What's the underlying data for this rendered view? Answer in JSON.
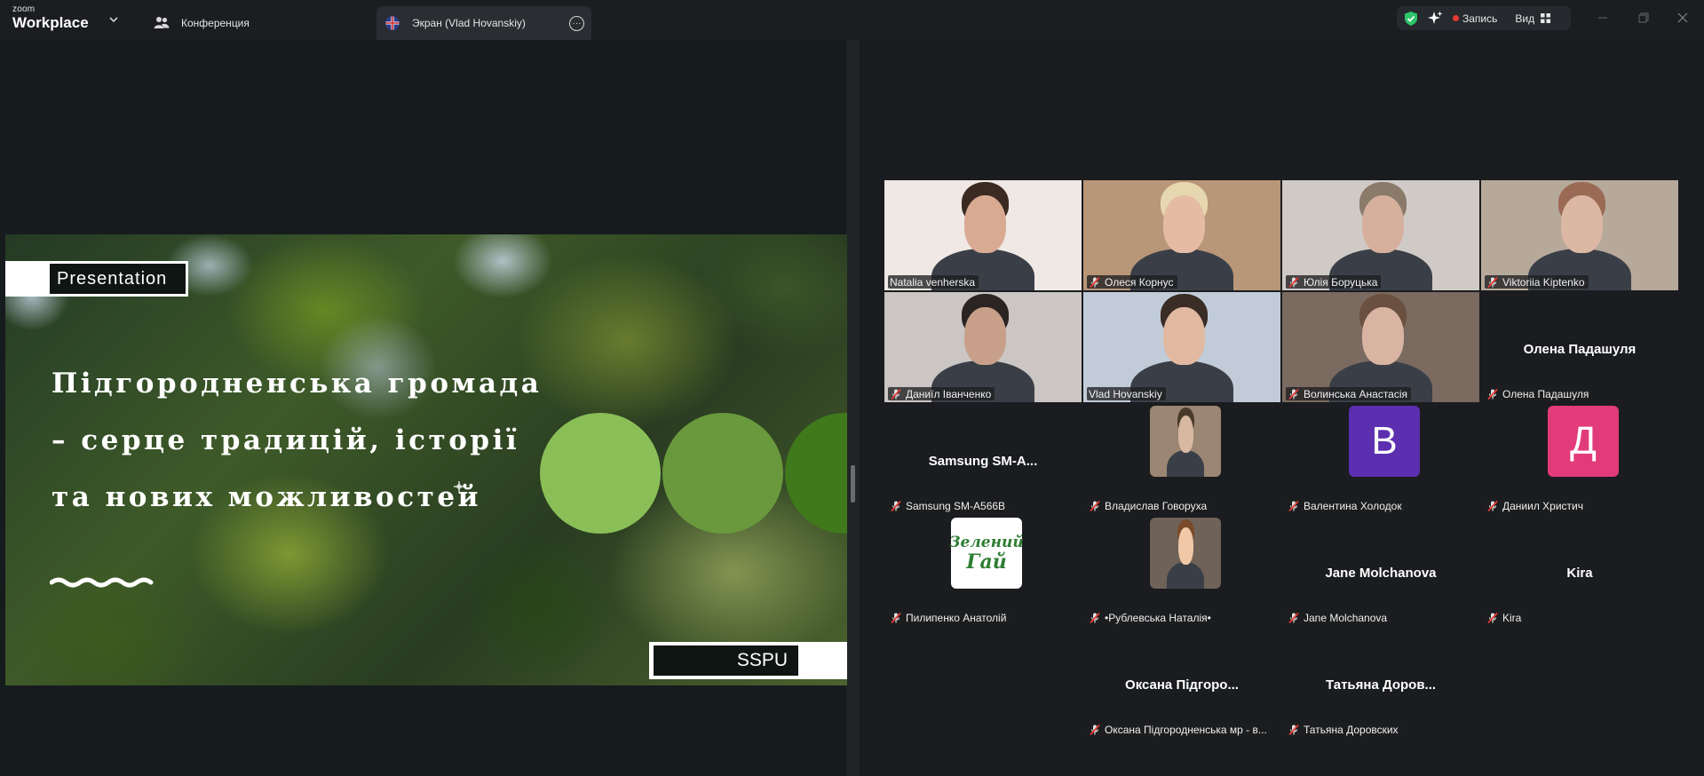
{
  "titlebar": {
    "brand_top": "zoom",
    "brand_bottom": "Workplace",
    "tab_conference": "Конференция",
    "tab_share": "Экран (Vlad Hovanskiy)",
    "record_label": "Запись",
    "view_label": "Вид"
  },
  "slide": {
    "tag": "Presentation",
    "title_lines": [
      "Підгородненська громада",
      "– серце традицій, історії",
      "та нових можливостей"
    ],
    "footer_tag": "SSPU"
  },
  "participants": [
    {
      "name": "Natalia venherska",
      "muted": false,
      "video": true,
      "active": true,
      "skin": "#d9aa92",
      "hair": "#3a2a22",
      "bg": "#efe8e5"
    },
    {
      "name": "Олеся Корнус",
      "muted": true,
      "video": true,
      "skin": "#e4bca4",
      "hair": "#e6d7b0",
      "bg": "#b89678"
    },
    {
      "name": "Юлія Боруцька",
      "muted": true,
      "video": true,
      "skin": "#d6b09c",
      "hair": "#8a7a6a",
      "bg": "#cfcac5"
    },
    {
      "name": "Viktoriia Kiptenko",
      "muted": true,
      "video": true,
      "skin": "#dcb7a4",
      "hair": "#9a6a55",
      "bg": "#b6a99a"
    },
    {
      "name": "Даниїл Іванченко",
      "muted": true,
      "video": true,
      "skin": "#c8a08a",
      "hair": "#2a2522",
      "bg": "#cbc6c4"
    },
    {
      "name": "Vlad Hovanskiy",
      "muted": false,
      "video": true,
      "skin": "#e1b8a0",
      "hair": "#3a2d25",
      "bg": "#c2ccd8"
    },
    {
      "name": "Волинська Анастасія",
      "muted": true,
      "video": true,
      "skin": "#d9b4a2",
      "hair": "#6a5040",
      "bg": "#7a6a60"
    },
    {
      "name": "Олена Падашуля",
      "muted": true,
      "video": false,
      "display": "Олена Падашуля"
    },
    {
      "name": "Samsung SM-A566B",
      "muted": true,
      "video": false,
      "display": "Samsung SM-A..."
    },
    {
      "name": "Владислав Говоруха",
      "muted": true,
      "video": false,
      "photo": true,
      "skin": "#d8b8a0",
      "hair": "#4a3a2a",
      "bg": "#9a8672"
    },
    {
      "name": "Валентина Холодок",
      "muted": true,
      "video": false,
      "letter": "В",
      "color": "#5b2fb0"
    },
    {
      "name": "Даниил Христич",
      "muted": true,
      "video": false,
      "letter": "Д",
      "color": "#e23b7a"
    },
    {
      "name": "Пилипенко Анатолій",
      "muted": true,
      "video": false,
      "logo": true,
      "logo_top": "Зелений",
      "logo_bottom": "Гай"
    },
    {
      "name": "•Рублевська Наталія•",
      "muted": true,
      "video": false,
      "photo": true,
      "cartoon": true,
      "skin": "#f1c9a8",
      "hair": "#7a4a2a",
      "bg": "#6e6259"
    },
    {
      "name": "Jane Molchanova",
      "muted": true,
      "video": false,
      "display": "Jane Molchanova"
    },
    {
      "name": "Kira",
      "muted": true,
      "video": false,
      "display": "Kira"
    },
    {
      "name": "Оксана Підгородненська мр - в...",
      "muted": true,
      "video": false,
      "display": "Оксана  Підгоро..."
    },
    {
      "name": "Татьяна Доровских",
      "muted": true,
      "video": false,
      "display": "Татьяна  Доров..."
    }
  ]
}
